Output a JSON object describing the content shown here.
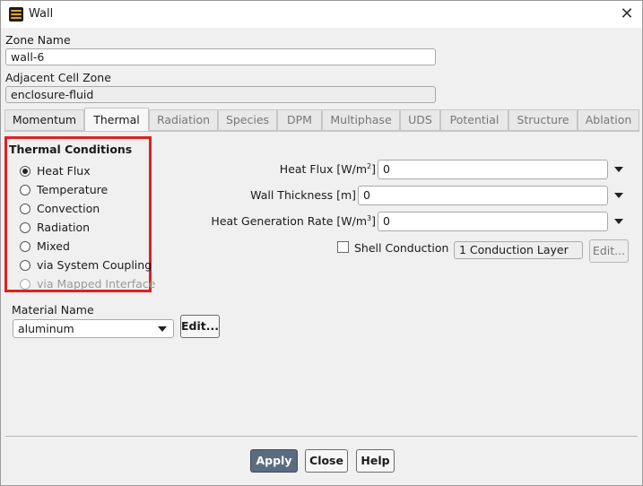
{
  "window": {
    "title": "Wall",
    "close_glyph": "✕",
    "icon": "fluent-app-icon"
  },
  "zone": {
    "name_label": "Zone Name",
    "name_value": "wall-6",
    "adjacent_label": "Adjacent Cell Zone",
    "adjacent_value": "enclosure-fluid"
  },
  "tabs": [
    "Momentum",
    "Thermal",
    "Radiation",
    "Species",
    "DPM",
    "Multiphase",
    "UDS",
    "Potential",
    "Structure",
    "Ablation"
  ],
  "active_tab": "Thermal",
  "thermal_conditions": {
    "title": "Thermal Conditions",
    "options": [
      "Heat Flux",
      "Temperature",
      "Convection",
      "Radiation",
      "Mixed",
      "via System Coupling",
      "via Mapped Interface"
    ],
    "selected": "Heat Flux",
    "disabled": [
      "via Mapped Interface"
    ],
    "highlight_color": "#e02020"
  },
  "material": {
    "label": "Material Name",
    "value": "aluminum",
    "edit_label": "Edit..."
  },
  "fields": {
    "heat_flux": {
      "label": "Heat Flux [W/m",
      "sup": "2",
      "close": "]",
      "value": "0"
    },
    "wall_thickness": {
      "label": "Wall Thickness [m]",
      "value": "0"
    },
    "heat_gen": {
      "label": "Heat Generation Rate [W/m",
      "sup": "3",
      "close": "]",
      "value": "0"
    }
  },
  "shell": {
    "label": "Shell Conduction",
    "checked": false,
    "layers": "1 Conduction Layer",
    "edit_label": "Edit..."
  },
  "buttons": {
    "apply": "Apply",
    "close": "Close",
    "help": "Help"
  },
  "colors": {
    "apply_bg": "#5b6b80"
  }
}
